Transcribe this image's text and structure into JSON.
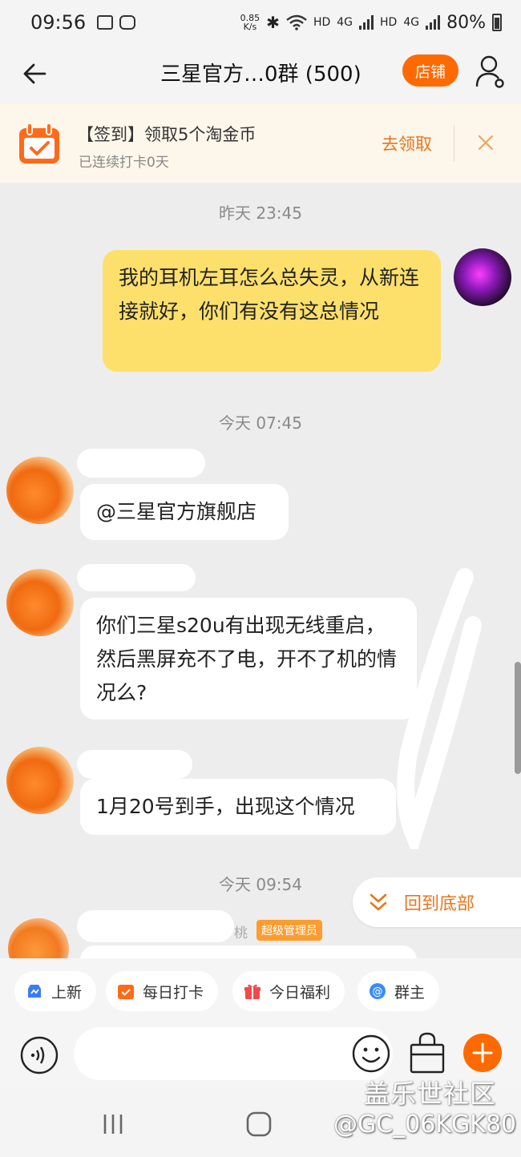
{
  "status_bar": {
    "time": "09:56",
    "net_speed_value": "0.85",
    "net_speed_unit": "K/s",
    "hd1": "HD",
    "net1": "4G",
    "hd2": "HD",
    "net2": "4G",
    "battery": "80%"
  },
  "nav": {
    "title": "三星官方…0群 (500)",
    "shop_label": "店铺"
  },
  "checkin": {
    "title": "【签到】领取5个淘金币",
    "subtitle": "已连续打卡0天",
    "claim_label": "去领取"
  },
  "messages": {
    "ts1": "昨天  23:45",
    "msg_mine": "我的耳机左耳怎么总失灵，从新连接就好，你们有没有这总情况",
    "ts2": "今天  07:45",
    "msg1": "@三星官方旗舰店",
    "msg2": "你们三星s20u有出现无线重启，然后黑屏充不了电，开不了机的情况么?",
    "msg3": "1月20号到手，出现这个情况",
    "ts3": "今天  09:54",
    "partial_name": "桃",
    "admin_badge": "超级管理员"
  },
  "back_to_bottom": "回到底部",
  "quick_actions": [
    {
      "label": "上新",
      "icon": "new-arrivals-icon"
    },
    {
      "label": "每日打卡",
      "icon": "calendar-check-icon"
    },
    {
      "label": "今日福利",
      "icon": "gift-icon"
    },
    {
      "label": "群主",
      "icon": "at-icon"
    }
  ],
  "input": {
    "placeholder": ""
  },
  "watermark": {
    "line1": "盖乐世社区",
    "line2": "@GC_06KGK80"
  },
  "colors": {
    "accent": "#ff6a00",
    "my_bubble": "#fde06b",
    "link_orange": "#e8761c"
  }
}
